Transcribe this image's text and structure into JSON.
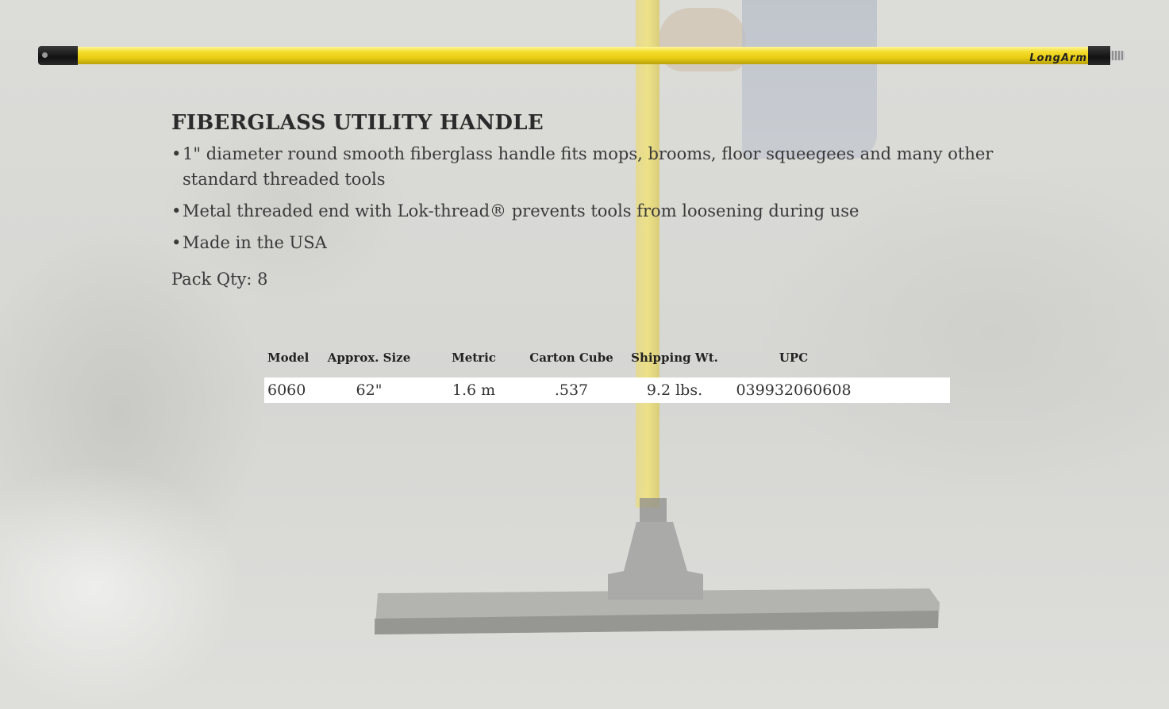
{
  "product": {
    "title": "FIBERGLASS UTILITY HANDLE",
    "bullets": [
      "1\" diameter round smooth fiberglass handle fits mops, brooms, floor squeegees and many other standard threaded tools",
      "Metal threaded end with Lok-thread® prevents tools from loosening during use",
      "Made in the USA"
    ],
    "pack_qty": "Pack Qty: 8",
    "handle_brand": "LongArm",
    "handle_color": "#f0d61e"
  },
  "spec_table": {
    "headers": [
      "Model",
      "Approx. Size",
      "Metric",
      "Carton Cube",
      "Shipping Wt.",
      "UPC"
    ],
    "rows": [
      [
        "6060",
        "62\"",
        "1.6 m",
        ".537",
        "9.2 lbs.",
        "039932060608"
      ]
    ]
  }
}
